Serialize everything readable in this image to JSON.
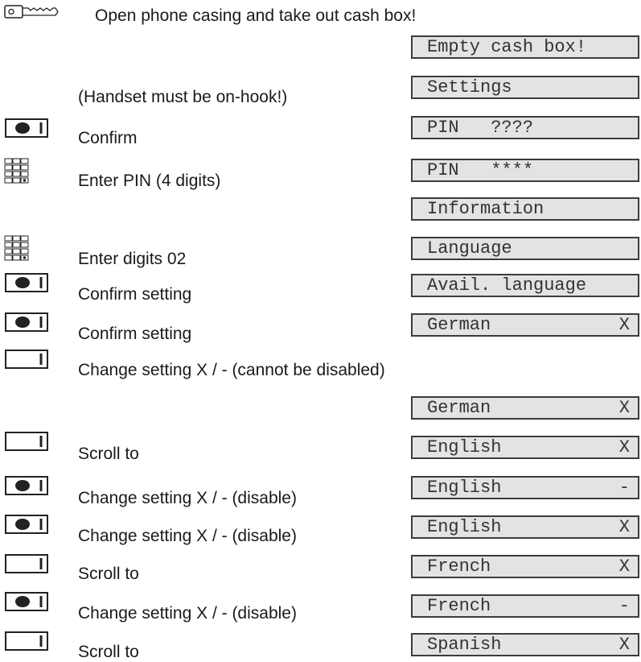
{
  "steps": [
    {
      "icon": "key-icon",
      "text": "Open phone casing and take out cash box!"
    },
    {
      "icon": "",
      "text": "(Handset must be on-hook!)"
    },
    {
      "icon": "confirm-key-icon",
      "text": "Confirm"
    },
    {
      "icon": "keypad-icon",
      "text": "Enter PIN (4 digits)"
    },
    {
      "icon": "keypad-icon",
      "text": "Enter digits 02"
    },
    {
      "icon": "confirm-key-icon",
      "text": "Confirm setting"
    },
    {
      "icon": "confirm-key-icon",
      "text": "Confirm setting"
    },
    {
      "icon": "scroll-key-icon",
      "text": "Change setting X / - (cannot be disabled)"
    },
    {
      "icon": "scroll-key-icon",
      "text": "Scroll to"
    },
    {
      "icon": "confirm-key-icon",
      "text": "Change setting X / - (disable)"
    },
    {
      "icon": "confirm-key-icon",
      "text": "Change setting X / - (disable)"
    },
    {
      "icon": "scroll-key-icon",
      "text": "Scroll to"
    },
    {
      "icon": "confirm-key-icon",
      "text": "Change setting X / - (disable)"
    },
    {
      "icon": "scroll-key-icon",
      "text": "Scroll to"
    }
  ],
  "displays": [
    {
      "text": "Empty cash box!",
      "flag": ""
    },
    {
      "text": "Settings",
      "flag": ""
    },
    {
      "text": "PIN   ????",
      "flag": ""
    },
    {
      "text": "PIN   ****",
      "flag": ""
    },
    {
      "text": "Information",
      "flag": ""
    },
    {
      "text": "Language",
      "flag": ""
    },
    {
      "text": "Avail. language",
      "flag": ""
    },
    {
      "text": "German",
      "flag": "X"
    },
    {
      "text": "German",
      "flag": "X"
    },
    {
      "text": "English",
      "flag": "X"
    },
    {
      "text": "English",
      "flag": "-"
    },
    {
      "text": "English",
      "flag": "X"
    },
    {
      "text": "French",
      "flag": "X"
    },
    {
      "text": "French",
      "flag": "-"
    },
    {
      "text": "Spanish",
      "flag": "X"
    }
  ]
}
